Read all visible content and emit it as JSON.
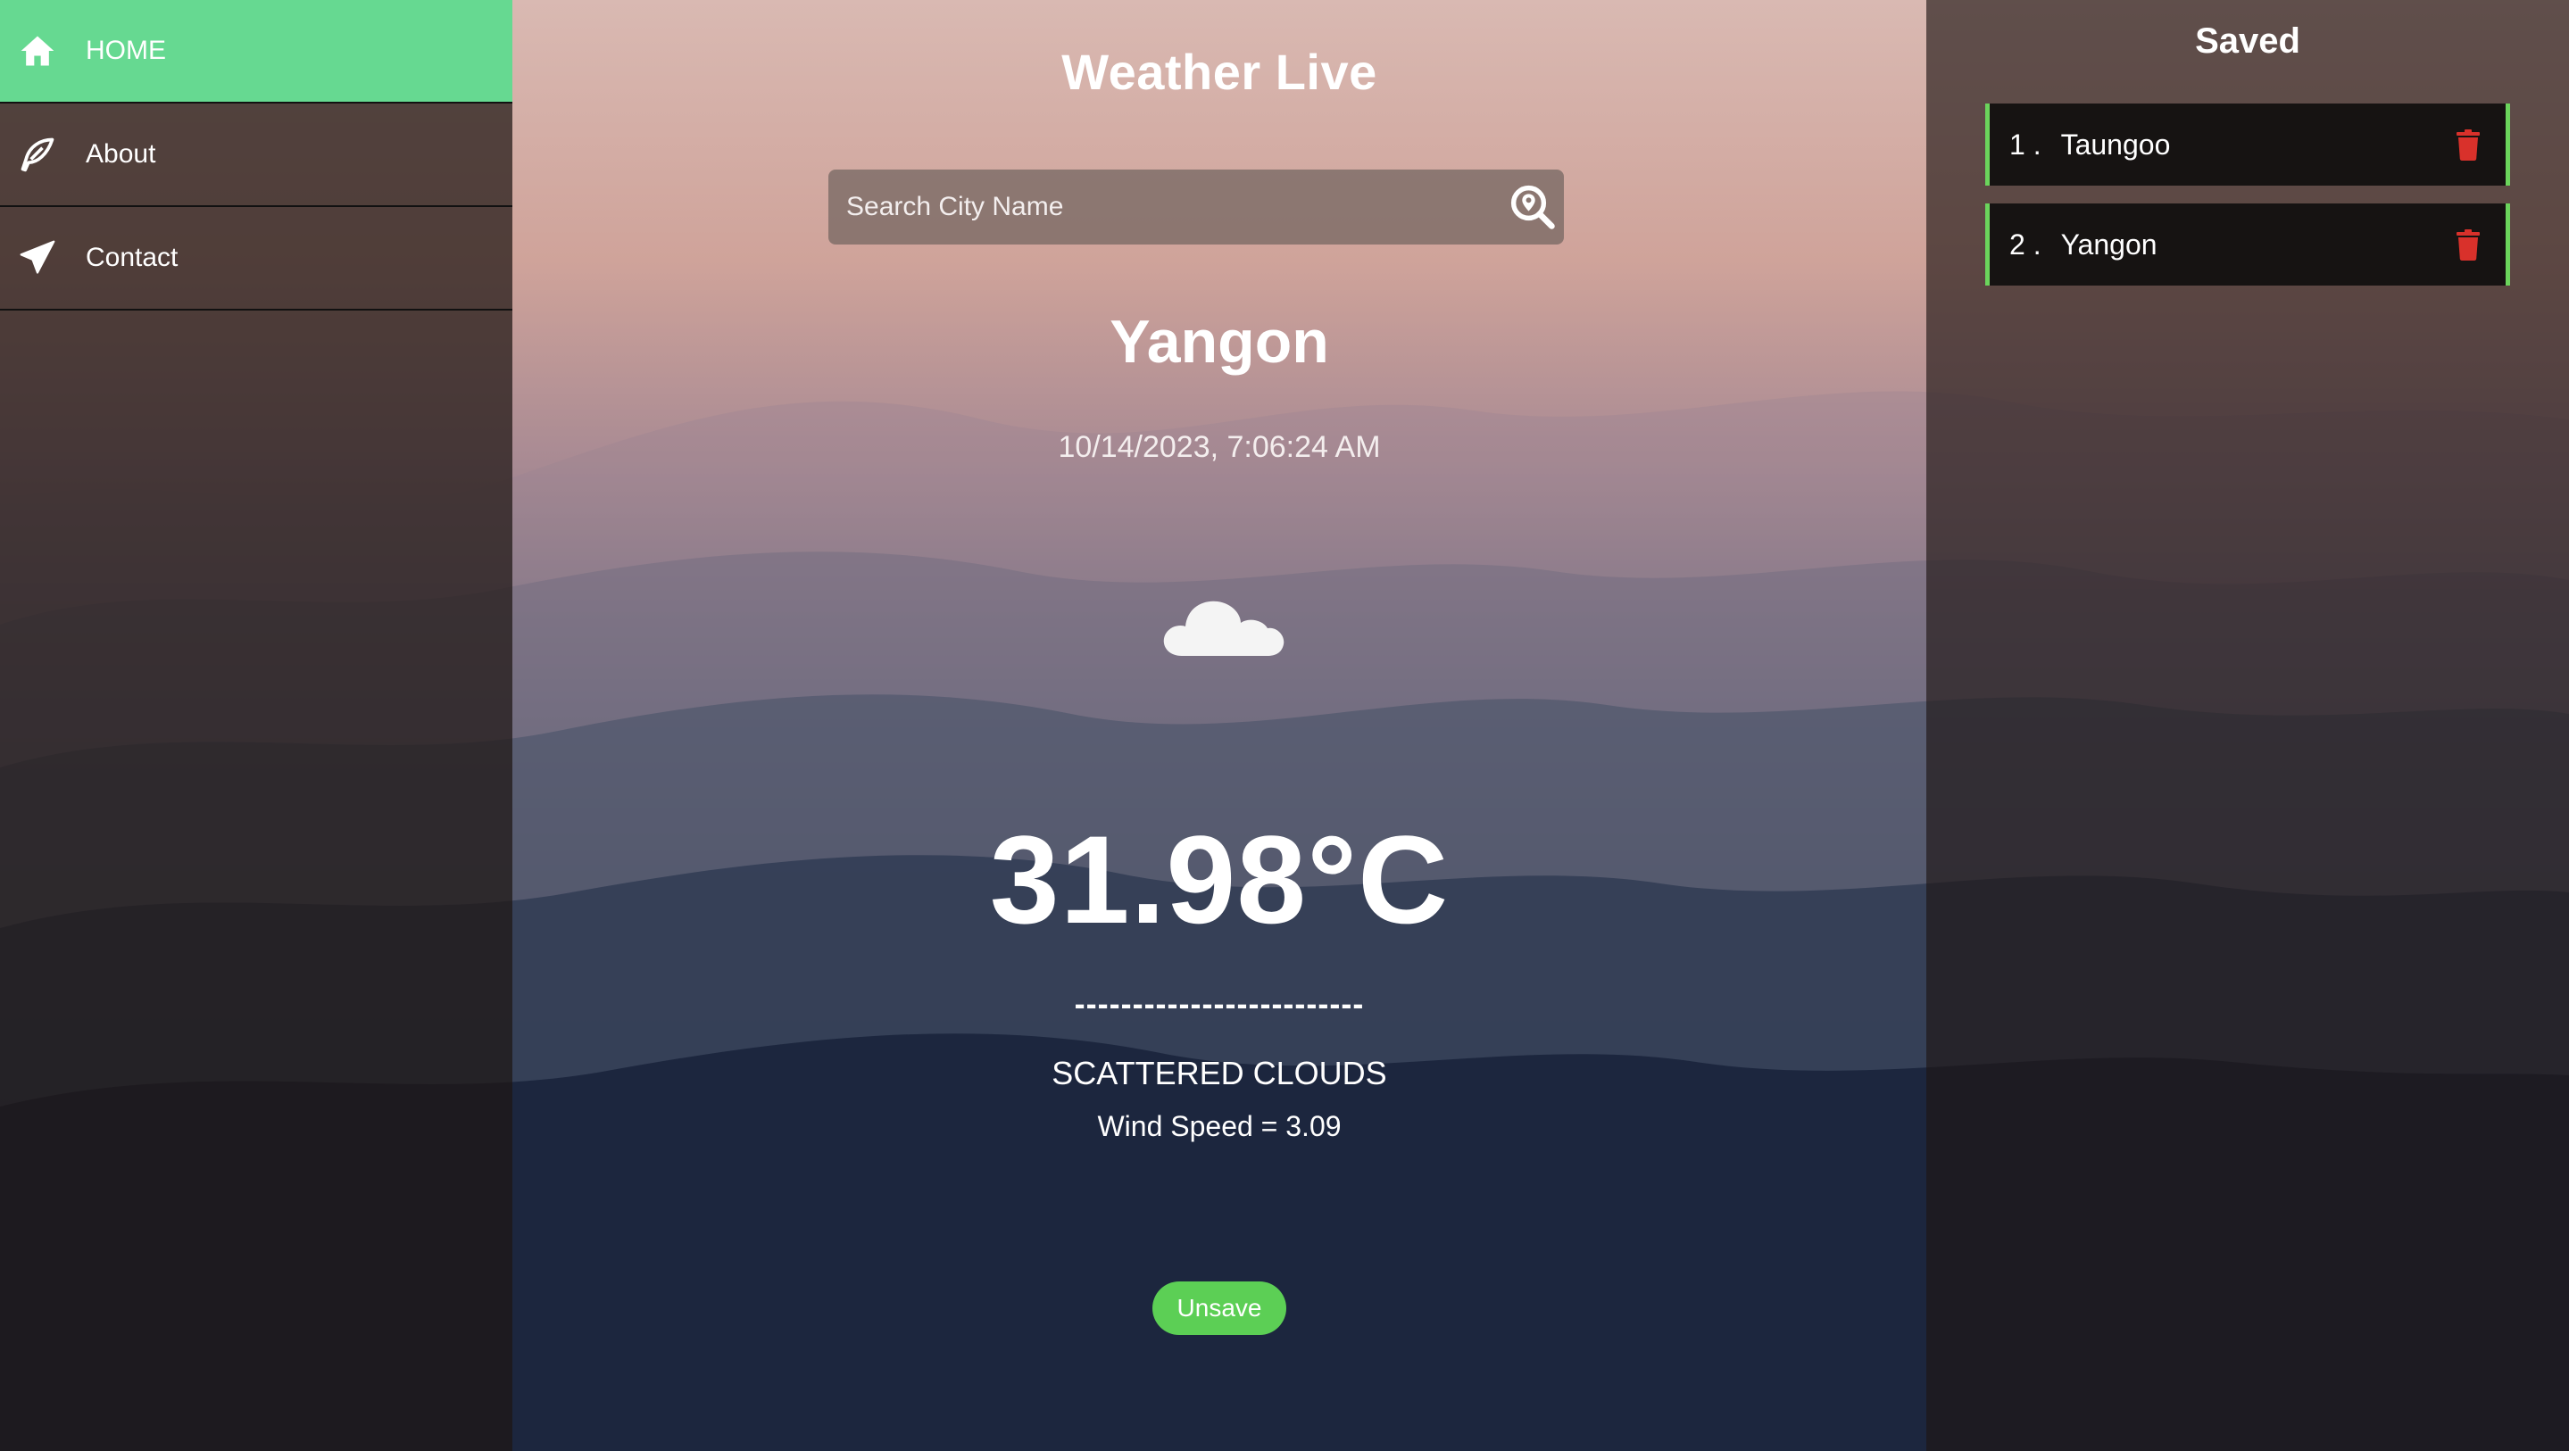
{
  "nav": {
    "items": [
      {
        "label": "HOME",
        "icon": "home-icon",
        "active": true
      },
      {
        "label": "About",
        "icon": "feather-icon",
        "active": false
      },
      {
        "label": "Contact",
        "icon": "paper-plane-icon",
        "active": false
      }
    ]
  },
  "main": {
    "title": "Weather Live",
    "search_placeholder": "Search City Name",
    "city": "Yangon",
    "datetime": "10/14/2023, 7:06:24 AM",
    "weather_icon": "cloud-icon",
    "temperature": "31.98°C",
    "divider": "-------------------------",
    "description": "SCATTERED CLOUDS",
    "wind": "Wind Speed = 3.09",
    "unsave_label": "Unsave"
  },
  "saved": {
    "title": "Saved",
    "items": [
      {
        "num": "1 .",
        "name": "Taungoo"
      },
      {
        "num": "2 .",
        "name": "Yangon"
      }
    ]
  },
  "colors": {
    "accent_green": "#66d991",
    "button_green": "#5ccf55",
    "trash_red": "#d9312b"
  }
}
